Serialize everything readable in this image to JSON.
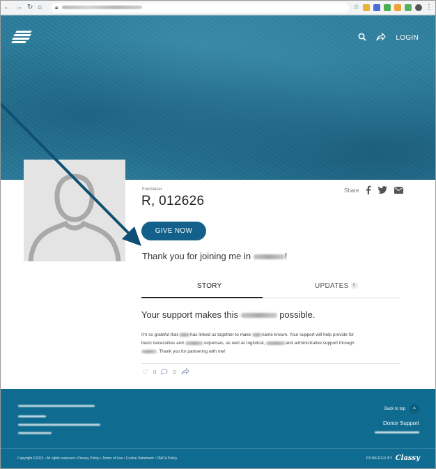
{
  "browser": {
    "nav_icons": [
      "arrow-left-icon",
      "arrow-right-icon",
      "reload-icon",
      "home-icon"
    ],
    "extension_colors": [
      "#e8b33b",
      "#4b6bd6",
      "#4caf50",
      "#f0a23a",
      "#58b15f",
      "#555555"
    ]
  },
  "header": {
    "login_label": "LOGIN",
    "colors": {
      "hero": "#2a7d9c",
      "brand": "#13618a"
    }
  },
  "fundraiser": {
    "eyebrow": "Fundraiser",
    "title": "R, 012626",
    "give_label": "GIVE NOW",
    "thanks_prefix": "Thank you for joining me in ",
    "thanks_suffix": "!",
    "share_label": "Share"
  },
  "tabs": {
    "story": "STORY",
    "updates": "UPDATES",
    "updates_count": "0"
  },
  "story": {
    "headline_prefix": "Your support makes this ",
    "headline_suffix": " possible.",
    "line1_a": "I'm so grateful that ",
    "line1_b": "has linked us together to make ",
    "line1_c": "name known. Your support will help provide for",
    "line2_a": "basic necessities and ",
    "line2_b": " expenses, as well as logistical, ",
    "line2_c": "and administrative support through",
    "line3_b": ". Thank you for partnering with me!",
    "like_count": "0",
    "comment_count": "0"
  },
  "footer": {
    "back_to_top": "Back to top",
    "donor_support": "Donor Support",
    "copyright": "Copyright ©2021 • All rights reserved • Privacy Policy • Terms of Use • Cookie Statement • DMCA Policy",
    "powered_by": "POWERED BY",
    "brand": "Classy"
  }
}
